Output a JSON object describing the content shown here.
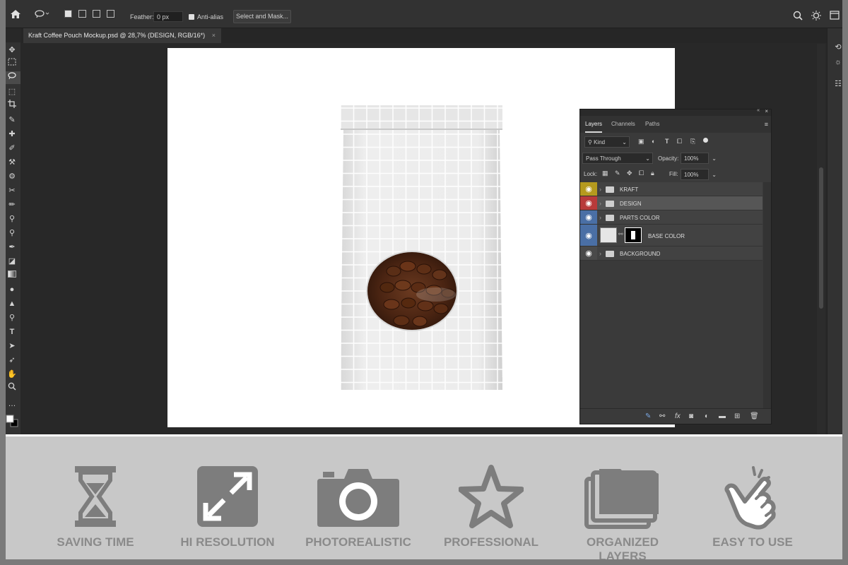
{
  "app": {
    "options": {
      "feather_label": "Feather:",
      "feather_value": "0 px",
      "antialias_label": "Anti-alias",
      "select_mask_label": "Select and Mask..."
    },
    "document_tab": {
      "title": "Kraft Coffee Pouch Mockup.psd @ 28,7% (DESIGN, RGB/16*)",
      "close": "×"
    },
    "layers_panel": {
      "tabs": [
        "Layers",
        "Channels",
        "Paths"
      ],
      "kind_label": "Kind",
      "blend_mode": "Pass Through",
      "opacity_label": "Opacity:",
      "opacity_value": "100%",
      "lock_label": "Lock:",
      "fill_label": "Fill:",
      "fill_value": "100%",
      "layers": [
        {
          "name": "KRAFT",
          "eye_color": "#b59a1e",
          "type": "group"
        },
        {
          "name": "DESIGN",
          "eye_color": "#b83a3a",
          "type": "group",
          "selected": true
        },
        {
          "name": "PARTS COLOR",
          "eye_color": "#4a6fa5",
          "type": "group"
        },
        {
          "name": "BASE COLOR",
          "eye_color": "#4a6fa5",
          "type": "layer"
        },
        {
          "name": "BACKGROUND",
          "eye_color": "#4a4a4a",
          "type": "group"
        }
      ]
    }
  },
  "features": [
    {
      "label": "SAVING TIME",
      "icon": "hourglass-icon"
    },
    {
      "label": "HI RESOLUTION",
      "icon": "expand-arrows-icon"
    },
    {
      "label": "PHOTOREALISTIC",
      "icon": "camera-icon"
    },
    {
      "label": "PROFESSIONAL",
      "icon": "star-icon"
    },
    {
      "label": "ORGANIZED LAYERS",
      "icon": "stacked-folders-icon"
    },
    {
      "label": "EASY TO USE",
      "icon": "pointing-hand-icon"
    }
  ],
  "colors": {
    "icon_gray": "#7d7d7d",
    "banner_bg": "#c8c8c8",
    "app_bg": "#282828"
  }
}
